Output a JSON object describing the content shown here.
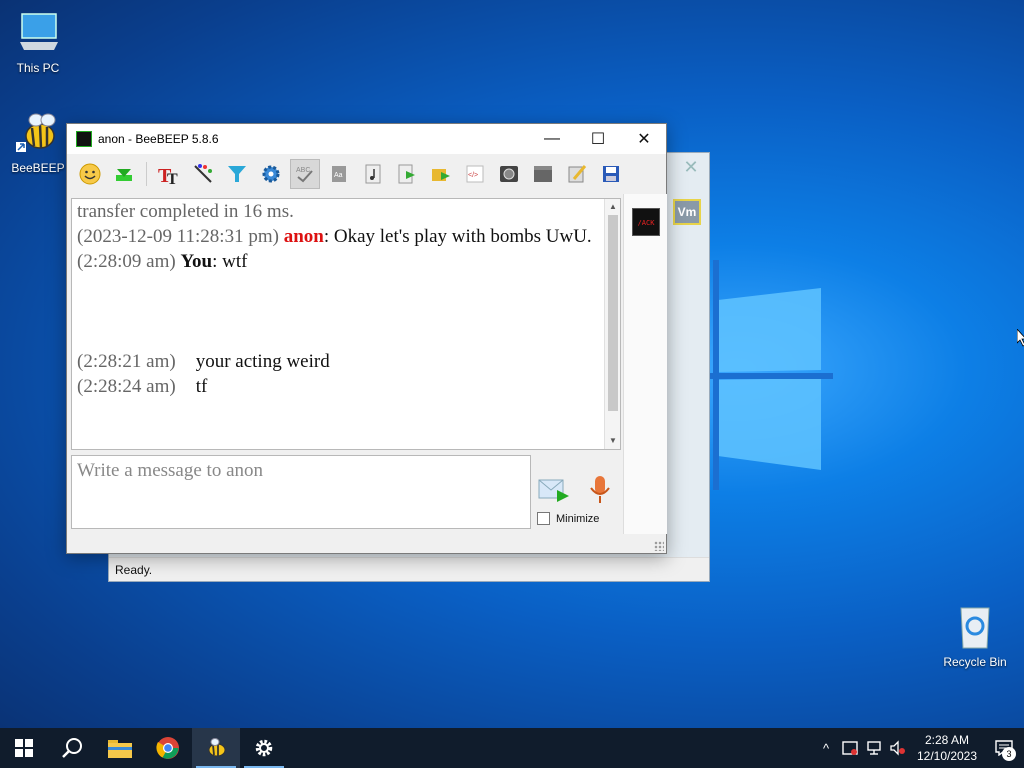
{
  "desktop": {
    "icons": [
      {
        "label": "This PC"
      },
      {
        "label": "BeeBEEP"
      },
      {
        "label": "Recycle Bin"
      }
    ]
  },
  "back_window": {
    "close_glyph": "✕",
    "status_text": "Ready.",
    "vm_badge": "Vm"
  },
  "main_window": {
    "title": "anon - BeeBEEP 5.8.6",
    "controls": {
      "minimize": "—",
      "maximize": "☐",
      "close": "✕"
    },
    "toolbar": [
      {
        "name": "emoticons-icon"
      },
      {
        "name": "send-file-icon"
      },
      {
        "name": "font-icon"
      },
      {
        "name": "font-color-icon"
      },
      {
        "name": "filter-icon"
      },
      {
        "name": "settings-icon"
      },
      {
        "name": "spellcheck-icon"
      },
      {
        "name": "dictionary-icon"
      },
      {
        "name": "sound-icon"
      },
      {
        "name": "share-file-icon"
      },
      {
        "name": "send-folder-icon"
      },
      {
        "name": "html-code-icon"
      },
      {
        "name": "screenshot-icon"
      },
      {
        "name": "board-icon"
      },
      {
        "name": "edit-icon"
      },
      {
        "name": "save-chat-icon"
      }
    ],
    "chat": {
      "line1": "transfer completed in 16 ms.",
      "msg2_time": "(2023-12-09 11:28:31 pm)",
      "msg2_user": "anon",
      "msg2_text": ": Okay let's play with bombs UwU.",
      "msg3_time": "(2:28:09 am)",
      "msg3_user": "You",
      "msg3_text": ": wtf",
      "msg4_time": "(2:28:21 am)",
      "msg4_text": "your acting weird",
      "msg5_time": "(2:28:24 am)",
      "msg5_text": "tf"
    },
    "input_placeholder": "Write a message to anon",
    "minimize_label": "Minimize",
    "minimize_checked": false,
    "side_avatar_text": "/ACK"
  },
  "taskbar": {
    "clock_time": "2:28 AM",
    "clock_date": "12/10/2023",
    "notification_count": "3",
    "tray_chevron": "^"
  },
  "colors": {
    "desktop_blue": "#0a5fc4",
    "taskbar": "#101c2c",
    "anon_name": "#dd1111",
    "timestamp": "#666666"
  }
}
